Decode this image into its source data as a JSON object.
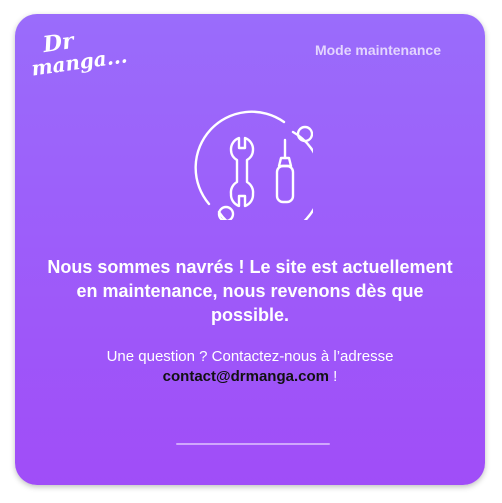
{
  "logo": {
    "line1": "Dr",
    "line2": "manga..."
  },
  "header": {
    "mode_label": "Mode maintenance"
  },
  "icon": {
    "name": "wrench-screwdriver-icon"
  },
  "message": {
    "headline": "Nous sommes navrés ! Le site est actuellement en maintenance, nous revenons dès que possible.",
    "question_prefix": "Une question ? Contactez-nous à l’adresse",
    "contact_email": "contact@drmanga.com",
    "question_suffix": " !"
  },
  "colors": {
    "gradient_top": "#9a6cfb",
    "gradient_bottom": "#a04df8",
    "email": "#111111"
  }
}
